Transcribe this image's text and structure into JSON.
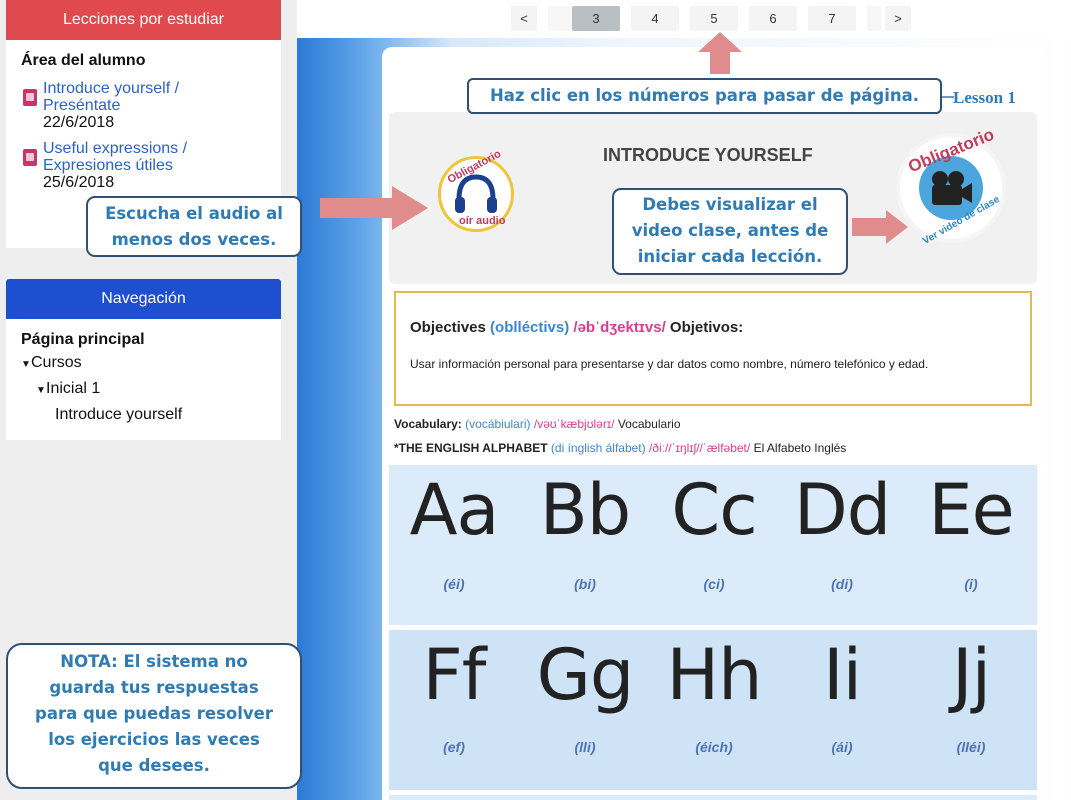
{
  "sidebar": {
    "lessons_block": {
      "header": "Lecciones por estudiar",
      "title": "Área del alumno",
      "items": [
        {
          "title_line1": "Introduce yourself /",
          "title_line2": "Preséntate",
          "date": "22/6/2018"
        },
        {
          "title_line1": "Useful expressions /",
          "title_line2": "Expresiones útiles",
          "date": "25/6/2018"
        }
      ]
    },
    "nav_block": {
      "header": "Navegación",
      "home": "Página principal",
      "cursos": "Cursos",
      "inicial": "Inicial 1",
      "lesson": "Introduce yourself"
    }
  },
  "pager": {
    "prev": "<",
    "pages": [
      "3",
      "4",
      "5",
      "6",
      "7"
    ],
    "active_page": "3",
    "next": ">"
  },
  "lesson": {
    "tag": "Lesson 1",
    "title": "INTRODUCE YOURSELF",
    "seal_audio": {
      "top": "Obligatorio",
      "bottom": "oír audio"
    },
    "seal_video": {
      "top": "Obligatorio",
      "bottom": "Ver video de clase"
    },
    "objectives": {
      "label": "Objectives",
      "phonetic_es": "(oblléctivs)",
      "ipa": "/əbˈdʒektɪvs/",
      "translation": "Objetivos:",
      "text": "Usar información personal para presentarse y dar datos como nombre, número telefónico y edad."
    },
    "vocab": {
      "label": "Vocabulary:",
      "phonetic_es": "(vocábiulari)",
      "ipa": "/vəʊˈkæbjʊlərɪ/",
      "translation": "Vocabulario"
    },
    "alphabet_heading": {
      "label": "*THE ENGLISH ALPHABET",
      "phonetic_es": "(di ínglish álfabet)",
      "ipa": "/ðiː//ˈɪŋlɪʃ//ˈælfəbet/",
      "translation": "El Alfabeto Inglés"
    },
    "alphabet_rows": [
      [
        {
          "letter": "Aa",
          "pron": "(éi)"
        },
        {
          "letter": "Bb",
          "pron": "(bi)"
        },
        {
          "letter": "Cc",
          "pron": "(ci)"
        },
        {
          "letter": "Dd",
          "pron": "(di)"
        },
        {
          "letter": "Ee",
          "pron": "(i)"
        }
      ],
      [
        {
          "letter": "Ff",
          "pron": "(ef)"
        },
        {
          "letter": "Gg",
          "pron": "(lli)"
        },
        {
          "letter": "Hh",
          "pron": "(éich)"
        },
        {
          "letter": "Ii",
          "pron": "(ái)"
        },
        {
          "letter": "Jj",
          "pron": "(lléi)"
        }
      ]
    ]
  },
  "callouts": {
    "pages": "Haz clic en los números para pasar de página.",
    "audio": [
      "Escucha el audio al",
      "menos dos veces."
    ],
    "video": [
      "Debes visualizar el",
      "video clase, antes de",
      "iniciar cada lección."
    ],
    "note": [
      "NOTA: El sistema no",
      "guarda tus respuestas",
      "para que puedas resolver",
      "los ejercicios las veces",
      "que desees."
    ]
  },
  "colors": {
    "lessons_header": "#e04a4f",
    "nav_header": "#1f4fd1",
    "callout_text": "#2f7bb4",
    "arrow": "#e08c8c",
    "objectives_border": "#e7b84a"
  }
}
